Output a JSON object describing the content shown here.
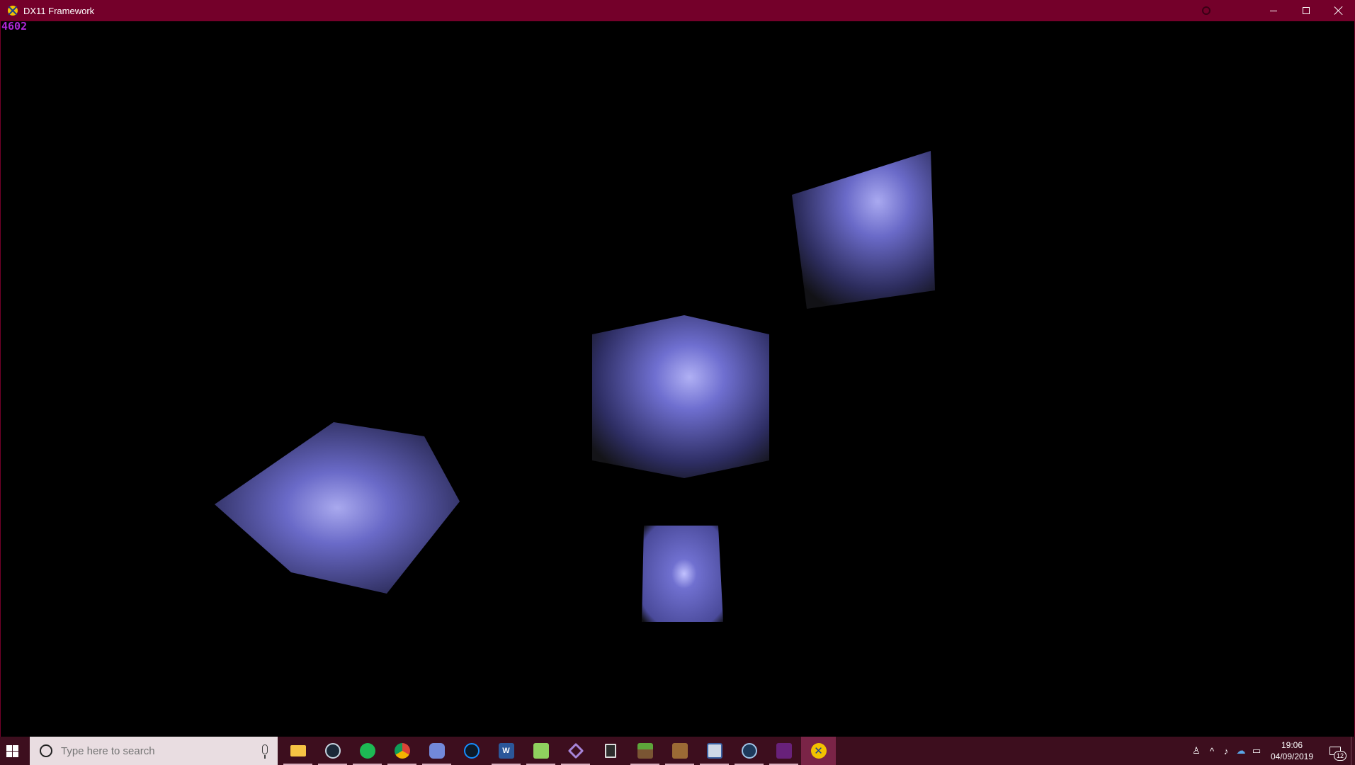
{
  "window": {
    "title": "DX11 Framework"
  },
  "viewport": {
    "fps_counter": "4602",
    "fps_color": "#b026d6",
    "cube_color": "#6a6ac8"
  },
  "taskbar": {
    "search_placeholder": "Type here to search",
    "apps": [
      {
        "name": "File Explorer",
        "icon": "folder-icon"
      },
      {
        "name": "Steam",
        "icon": "steam-icon"
      },
      {
        "name": "Spotify",
        "icon": "spotify-icon"
      },
      {
        "name": "Google Chrome",
        "icon": "chrome-icon"
      },
      {
        "name": "Discord",
        "icon": "discord-icon"
      },
      {
        "name": "Battle.net",
        "icon": "battlenet-icon"
      },
      {
        "name": "Microsoft Word",
        "icon": "word-icon"
      },
      {
        "name": "Notepad++",
        "icon": "notepadpp-icon"
      },
      {
        "name": "Visual Studio",
        "icon": "visual-studio-icon"
      },
      {
        "name": "Calculator",
        "icon": "calculator-icon"
      },
      {
        "name": "Minecraft",
        "icon": "minecraft-icon"
      },
      {
        "name": "Package",
        "icon": "package-icon"
      },
      {
        "name": "Snipping Tool",
        "icon": "snipping-icon"
      },
      {
        "name": "Steering Wheel App",
        "icon": "wheel-icon"
      },
      {
        "name": "Visual Studio Code",
        "icon": "vs-icon"
      },
      {
        "name": "DX11 Framework",
        "icon": "dx11-app-icon"
      }
    ],
    "clock_time": "19:06",
    "clock_date": "04/09/2019",
    "notification_count": "12"
  }
}
